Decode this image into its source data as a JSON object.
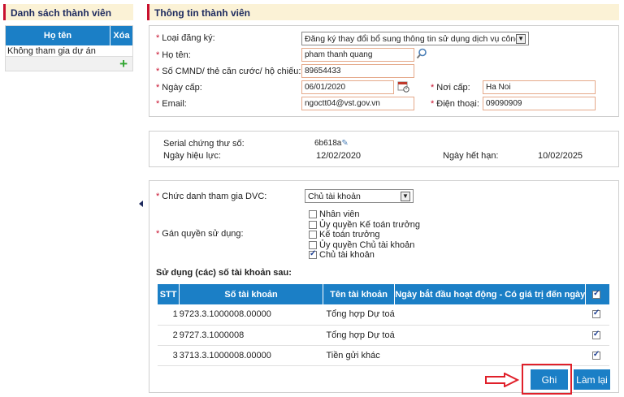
{
  "left_panel": {
    "title": "Danh sách thành viên",
    "col_name": "Họ tên",
    "col_delete": "Xóa",
    "row_text": "Không tham gia dự án",
    "add_icon": "plus-icon"
  },
  "right_panel": {
    "title": "Thông tin thành viên"
  },
  "form": {
    "reg_type_label": "Loại đăng ký:",
    "reg_type_value": "Đăng ký thay đổi bổ sung thông tin sử dụng dịch vụ công",
    "name_label": "Họ tên:",
    "name_value": "pham thanh quang",
    "id_label": "Số CMND/ thẻ căn cước/ hộ chiếu:",
    "id_value": "89654433",
    "issue_date_label": "Ngày cấp:",
    "issue_date_value": "06/01/2020",
    "issue_place_label": "Nơi cấp:",
    "issue_place_value": "Ha Noi",
    "email_label": "Email:",
    "email_value": "ngoctt04@vst.gov.vn",
    "phone_label": "Điện thoại:",
    "phone_value": "09090909"
  },
  "cert": {
    "serial_label": "Serial chứng thư số:",
    "serial_value": "6b618a",
    "valid_label": "Ngày hiệu lực:",
    "valid_value": "12/02/2020",
    "expire_label": "Ngày hết hạn:",
    "expire_value": "10/02/2025"
  },
  "role": {
    "title_label": "Chức danh tham gia DVC:",
    "title_value": "Chủ tài khoản",
    "perm_label": "Gán quyền sử dụng:",
    "perms": [
      {
        "label": "Nhân viên",
        "checked": false
      },
      {
        "label": "Ủy quyền Kế toán trưởng",
        "checked": false
      },
      {
        "label": "Kế toán trưởng",
        "checked": false
      },
      {
        "label": "Ủy quyền Chủ tài khoản",
        "checked": false
      },
      {
        "label": "Chủ tài khoản",
        "checked": true
      }
    ]
  },
  "accounts": {
    "heading": "Sử dụng (các) số tài khoản sau:",
    "headers": [
      "STT",
      "Số tài khoản",
      "Tên tài khoản",
      "Ngày bắt đầu hoạt động - Có giá trị đến ngày"
    ],
    "rows": [
      {
        "stt": "1",
        "number": "9723.3.1000008.00000",
        "name": "Tổng hợp Dự toá",
        "checked": true
      },
      {
        "stt": "2",
        "number": "9727.3.1000008",
        "name": "Tổng hợp Dự toá",
        "checked": true
      },
      {
        "stt": "3",
        "number": "3713.3.1000008.00000",
        "name": "Tiền gửi khác",
        "checked": true
      }
    ]
  },
  "buttons": {
    "save": "Ghi",
    "reset": "Làm lại"
  },
  "colors": {
    "accent_blue": "#1b7fc6",
    "highlight_red": "#e0202a",
    "header_bg": "#fbf2d6"
  }
}
